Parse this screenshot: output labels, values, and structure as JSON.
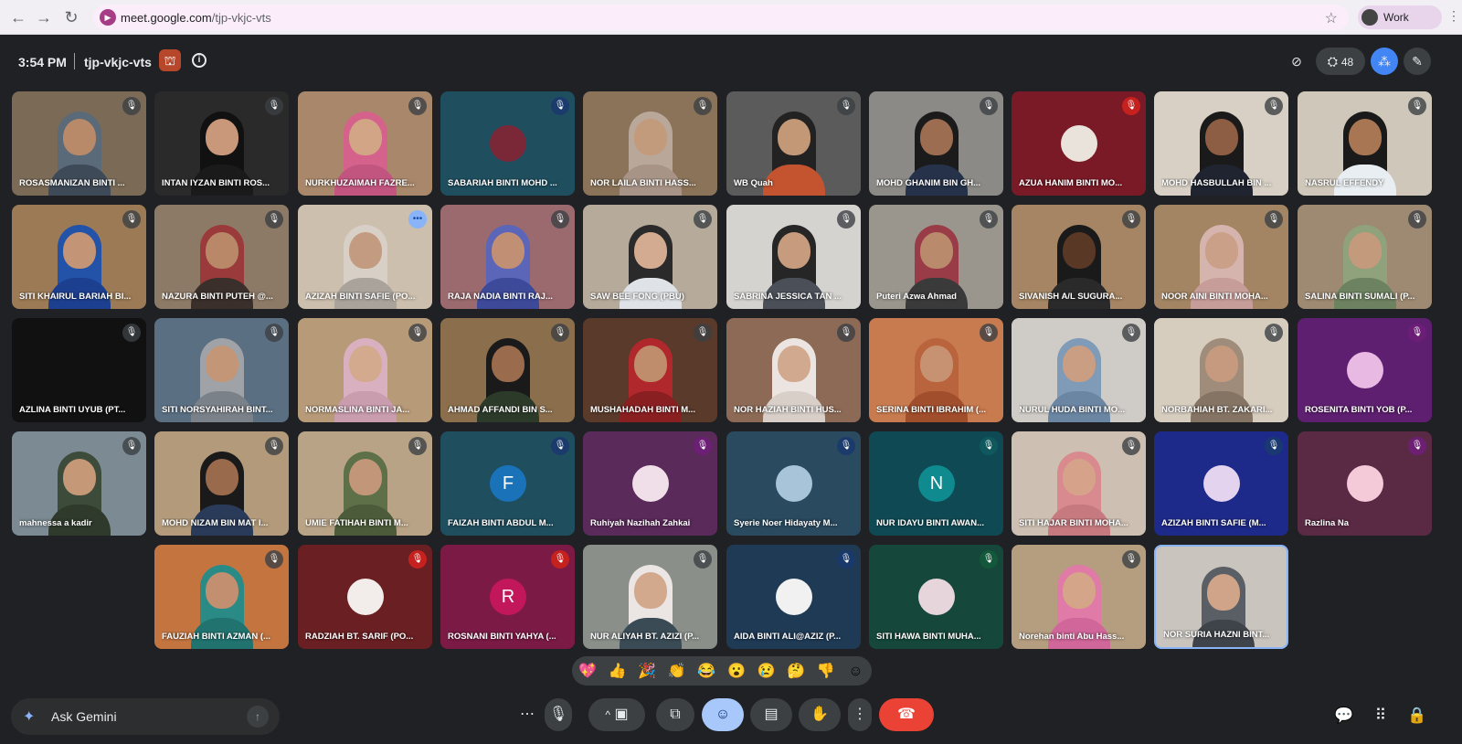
{
  "browser": {
    "url_host": "meet.google.com",
    "url_path": "/tjp-vkjc-vts",
    "profile_label": "Work"
  },
  "header": {
    "time": "3:54 PM",
    "meeting_code": "tjp-vkjc-vts",
    "participant_count": "48"
  },
  "participants": [
    {
      "name": "ROSASMANIZAN BINTI ...",
      "type": "video",
      "bg": "#7a6a56",
      "skin": "#b98a6a",
      "veil": "#5b6a78",
      "body": "#3e4a58",
      "mic": "muted"
    },
    {
      "name": "INTAN IYZAN BINTI ROS...",
      "type": "video",
      "bg": "#2a2a2a",
      "skin": "#c9987a",
      "veil": "#111111",
      "body": "#1a1a1a",
      "mic": "muted"
    },
    {
      "name": "NURKHUZAIMAH FAZRE...",
      "type": "video",
      "bg": "#a8876a",
      "skin": "#d1a585",
      "veil": "#d4628a",
      "body": "#c25580",
      "mic": "muted"
    },
    {
      "name": "SABARIAH BINTI MOHD ...",
      "type": "avatar",
      "bg": "#1f4e5f",
      "avatar_bg": "#7a2838",
      "initial": "",
      "mic": "muted-blue"
    },
    {
      "name": "NOR LAILA BINTI HASS...",
      "type": "video",
      "bg": "#8a7358",
      "skin": "#c29a7c",
      "veil": "#b9a79a",
      "body": "#a89486",
      "mic": "muted"
    },
    {
      "name": "WB Quah",
      "type": "video",
      "bg": "#5b5b5b",
      "skin": "#c39877",
      "veil": "#222222",
      "body": "#c4542f",
      "mic": "muted"
    },
    {
      "name": "MOHD GHANIM BIN GH...",
      "type": "video",
      "bg": "#8b8a86",
      "skin": "#9c6d50",
      "veil": "#1b1b1b",
      "body": "#25324a",
      "mic": "muted"
    },
    {
      "name": "AZUA HANIM BINTI MO...",
      "type": "avatar",
      "bg": "#7a1a26",
      "avatar_bg": "#e9e3dc",
      "initial": "",
      "mic": "muted-red"
    },
    {
      "name": "MOHD HASBULLAH BIN ...",
      "type": "video",
      "bg": "#d8d0c4",
      "skin": "#8d5e43",
      "veil": "#1a1a1a",
      "body": "#1f2430",
      "mic": "muted"
    },
    {
      "name": "NASRUL EFFENDY",
      "type": "video",
      "bg": "#cfc7b9",
      "skin": "#a97654",
      "veil": "#1a1a1a",
      "body": "#e8eef2",
      "mic": "muted"
    },
    {
      "name": "SITI KHAIRUL BARIAH BI...",
      "type": "video",
      "bg": "#9b7a55",
      "skin": "#c39476",
      "veil": "#2353a8",
      "body": "#1d3f8f",
      "mic": "muted"
    },
    {
      "name": "NAZURA BINTI PUTEH @...",
      "type": "video",
      "bg": "#8d7a66",
      "skin": "#b98868",
      "veil": "#9a3a3a",
      "body": "#3a2f2a",
      "mic": "muted"
    },
    {
      "name": "AZIZAH BINTI SAFIE (PO...",
      "type": "video",
      "bg": "#cdbfae",
      "skin": "#c29b80",
      "veil": "#d8d0c7",
      "body": "#a9a39c",
      "mic": "more"
    },
    {
      "name": "RAJA NADIA BINTI RAJ...",
      "type": "video",
      "bg": "#9b6a6e",
      "skin": "#c18f74",
      "veil": "#5c66b8",
      "body": "#3d4a9a",
      "mic": "muted"
    },
    {
      "name": "SAW BEE FONG (PBU)",
      "type": "video",
      "bg": "#b6aa9b",
      "skin": "#d2ab90",
      "veil": "#2a2a2a",
      "body": "#dfe2e6",
      "mic": "muted"
    },
    {
      "name": "SABRINA JESSICA TAN ...",
      "type": "video",
      "bg": "#d5d3cf",
      "skin": "#c79b7d",
      "veil": "#262626",
      "body": "#4a4f58",
      "mic": "muted"
    },
    {
      "name": "Puteri Azwa Ahmad",
      "type": "video",
      "bg": "#9a968e",
      "skin": "#b98a6c",
      "veil": "#9a3b48",
      "body": "#3a3a3a",
      "mic": "muted"
    },
    {
      "name": "SIVANISH A/L SUGURA...",
      "type": "video",
      "bg": "#a58563",
      "skin": "#5a3826",
      "veil": "#1a1a1a",
      "body": "#2a2a2a",
      "mic": "muted"
    },
    {
      "name": "NOOR AINI BINTI MOHA...",
      "type": "video",
      "bg": "#a38564",
      "skin": "#caa089",
      "veil": "#d5b4ae",
      "body": "#c79d9a",
      "mic": "muted"
    },
    {
      "name": "SALINA BINTI SUMALI (P...",
      "type": "video",
      "bg": "#9e8a73",
      "skin": "#c49a7c",
      "veil": "#8fa27c",
      "body": "#6d8260",
      "mic": "muted"
    },
    {
      "name": "AZLINA BINTI UYUB (PT...",
      "type": "empty",
      "bg": "#111111",
      "mic": "muted"
    },
    {
      "name": "SITI NORSYAHIRAH BINT...",
      "type": "video",
      "bg": "#5a6f82",
      "skin": "#c39678",
      "veil": "#9fa3a8",
      "body": "#7b8189",
      "mic": "muted"
    },
    {
      "name": "NORMASLINA BINTI JA...",
      "type": "video",
      "bg": "#b79a78",
      "skin": "#d3aa8d",
      "veil": "#d9b0c0",
      "body": "#c99cae",
      "mic": "muted"
    },
    {
      "name": "AHMAD AFFANDI BIN S...",
      "type": "video",
      "bg": "#8b6f4d",
      "skin": "#9a6b4c",
      "veil": "#1a1a1a",
      "body": "#2c3a2a",
      "mic": "muted"
    },
    {
      "name": "MUSHAHADAH BINTI M...",
      "type": "video",
      "bg": "#5a3a2a",
      "skin": "#c08d6c",
      "veil": "#b0282c",
      "body": "#8a1f22",
      "mic": "muted"
    },
    {
      "name": "NOR HAZIAH BINTI HUS...",
      "type": "video",
      "bg": "#8d6a55",
      "skin": "#d1a98e",
      "veil": "#ece4e0",
      "body": "#d9cfc9",
      "mic": "muted"
    },
    {
      "name": "SERINA BINTI IBRAHIM (...",
      "type": "video",
      "bg": "#c87b4f",
      "skin": "#c79271",
      "veil": "#b9643c",
      "body": "#a14e2c",
      "mic": "muted"
    },
    {
      "name": "NURUL HUDA BINTI MO...",
      "type": "video",
      "bg": "#cfcbc6",
      "skin": "#c99e82",
      "veil": "#7f9bb8",
      "body": "#6b86a3",
      "mic": "muted"
    },
    {
      "name": "NORBAHIAH BT. ZAKARI...",
      "type": "video",
      "bg": "#d7cdbf",
      "skin": "#c59a7e",
      "veil": "#9f8c7a",
      "body": "#857464",
      "mic": "muted"
    },
    {
      "name": "ROSENITA BINTI YOB (P...",
      "type": "avatar",
      "bg": "#5e1f70",
      "avatar_bg": "#e7b9e3",
      "initial": "",
      "mic": "muted-purple"
    },
    {
      "name": "mahnessa a kadir",
      "type": "video",
      "bg": "#7b8a93",
      "skin": "#c59878",
      "veil": "#3d4c3a",
      "body": "#2f3a2c",
      "mic": "muted"
    },
    {
      "name": "MOHD NIZAM BIN MAT I...",
      "type": "video",
      "bg": "#b29a7a",
      "skin": "#9a6a4d",
      "veil": "#1a1a1a",
      "body": "#2a3b5a",
      "mic": "muted"
    },
    {
      "name": "UMIE FATIHAH BINTI M...",
      "type": "video",
      "bg": "#b9a386",
      "skin": "#c29679",
      "veil": "#5e7048",
      "body": "#4c5c3a",
      "mic": "muted"
    },
    {
      "name": "FAIZAH BINTI ABDUL M...",
      "type": "avatar",
      "bg": "#1f4e5f",
      "avatar_bg": "#1a73b8",
      "initial": "F",
      "mic": "muted-blue"
    },
    {
      "name": "Ruhiyah Nazihah Zahkai",
      "type": "avatar",
      "bg": "#5a2a5a",
      "avatar_bg": "#f0dfe8",
      "initial": "",
      "mic": "muted-purple"
    },
    {
      "name": "Syerie Noer Hidayaty M...",
      "type": "avatar",
      "bg": "#2a4a5f",
      "avatar_bg": "#a8c4d8",
      "initial": "",
      "mic": "muted-blue"
    },
    {
      "name": "NUR IDAYU BINTI AWAN...",
      "type": "avatar",
      "bg": "#0f4a54",
      "avatar_bg": "#0f8a8f",
      "initial": "N",
      "mic": "muted-teal"
    },
    {
      "name": "SITI HAJAR BINTI MOHA...",
      "type": "video",
      "bg": "#cdbfb1",
      "skin": "#d6a38a",
      "veil": "#d98a8e",
      "body": "#c67a80",
      "mic": "muted"
    },
    {
      "name": "AZIZAH BINTI SAFIE (M...",
      "type": "avatar",
      "bg": "#1e2a8a",
      "avatar_bg": "#e4d3ee",
      "initial": "",
      "mic": "muted-blue"
    },
    {
      "name": "Razlina Na",
      "type": "avatar",
      "bg": "#5a2a45",
      "avatar_bg": "#f4c9d8",
      "initial": "",
      "mic": "muted-purple"
    },
    {
      "name": "FAUZIAH BINTI AZMAN (...",
      "type": "video",
      "bg": "#c4753f",
      "skin": "#c28f70",
      "veil": "#2a8a86",
      "body": "#217370",
      "mic": "muted"
    },
    {
      "name": "RADZIAH BT. SARIF (PO...",
      "type": "avatar",
      "bg": "#6a1f22",
      "avatar_bg": "#f2ecea",
      "initial": "",
      "mic": "muted-red"
    },
    {
      "name": "ROSNANI BINTI YAHYA (...",
      "type": "avatar",
      "bg": "#7a1a45",
      "avatar_bg": "#c2185b",
      "initial": "R",
      "mic": "muted-red"
    },
    {
      "name": "NUR ALIYAH BT. AZIZI (P...",
      "type": "video",
      "bg": "#8a8f8a",
      "skin": "#d2a98d",
      "veil": "#ebe6e4",
      "body": "#3a4b56",
      "mic": "muted"
    },
    {
      "name": "AIDA BINTI ALI@AZIZ (P...",
      "type": "avatar",
      "bg": "#1f3a55",
      "avatar_bg": "#f1f1f1",
      "initial": "",
      "mic": "muted-blue"
    },
    {
      "name": "SITI HAWA BINTI MUHA...",
      "type": "avatar",
      "bg": "#15473a",
      "avatar_bg": "#e7d5dc",
      "initial": "",
      "mic": "muted-green"
    },
    {
      "name": "Norehan binti Abu Hass...",
      "type": "video",
      "bg": "#b59e80",
      "skin": "#d5a589",
      "veil": "#e07aa6",
      "body": "#d0669a",
      "mic": "muted"
    },
    {
      "name": "NOR SURIA HAZNI BINT...",
      "type": "video",
      "bg": "#c9c4bd",
      "skin": "#cfa488",
      "veil": "#5a5f66",
      "body": "#3f444a",
      "mic": "none",
      "active": true
    }
  ],
  "reactions": [
    "💖",
    "👍",
    "🎉",
    "👏",
    "😂",
    "😮",
    "😢",
    "🤔",
    "👎",
    "☺"
  ],
  "gemini": {
    "label": "Ask Gemini"
  },
  "colors": {
    "end_call": "#ea4335",
    "active_control": "#a8c7fa",
    "background": "#202124"
  }
}
